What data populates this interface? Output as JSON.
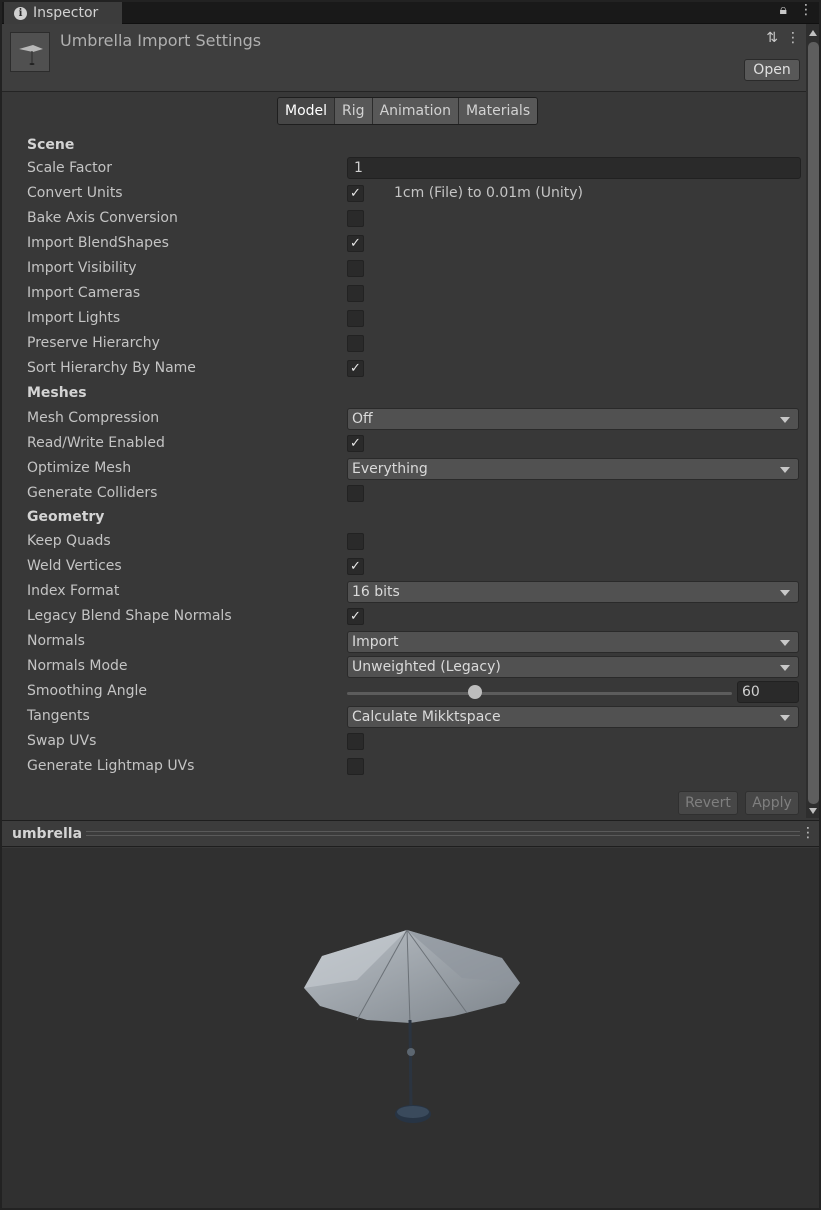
{
  "window": {
    "tab_label": "Inspector",
    "lock_icon": "lock-icon",
    "menu_icon": "kebab-menu-icon"
  },
  "header": {
    "title": "Umbrella Import Settings",
    "open_label": "Open"
  },
  "tabs": [
    "Model",
    "Rig",
    "Animation",
    "Materials"
  ],
  "scene": {
    "heading": "Scene",
    "scale_factor_label": "Scale Factor",
    "scale_factor_value": "1",
    "convert_units_label": "Convert Units",
    "convert_units_checked": true,
    "convert_units_text": "1cm (File) to 0.01m (Unity)",
    "bake_axis_label": "Bake Axis Conversion",
    "bake_axis_checked": false,
    "import_blendshapes_label": "Import BlendShapes",
    "import_blendshapes_checked": true,
    "import_visibility_label": "Import Visibility",
    "import_visibility_checked": false,
    "import_cameras_label": "Import Cameras",
    "import_cameras_checked": false,
    "import_lights_label": "Import Lights",
    "import_lights_checked": false,
    "preserve_hierarchy_label": "Preserve Hierarchy",
    "preserve_hierarchy_checked": false,
    "sort_hierarchy_label": "Sort Hierarchy By Name",
    "sort_hierarchy_checked": true
  },
  "meshes": {
    "heading": "Meshes",
    "mesh_compression_label": "Mesh Compression",
    "mesh_compression_value": "Off",
    "read_write_label": "Read/Write Enabled",
    "read_write_checked": true,
    "optimize_mesh_label": "Optimize Mesh",
    "optimize_mesh_value": "Everything",
    "generate_colliders_label": "Generate Colliders",
    "generate_colliders_checked": false
  },
  "geometry": {
    "heading": "Geometry",
    "keep_quads_label": "Keep Quads",
    "keep_quads_checked": false,
    "weld_vertices_label": "Weld Vertices",
    "weld_vertices_checked": true,
    "index_format_label": "Index Format",
    "index_format_value": "16 bits",
    "legacy_blend_label": "Legacy Blend Shape Normals",
    "legacy_blend_checked": true,
    "normals_label": "Normals",
    "normals_value": "Import",
    "normals_mode_label": "Normals Mode",
    "normals_mode_value": "Unweighted (Legacy)",
    "smoothing_angle_label": "Smoothing Angle",
    "smoothing_angle_value": "60",
    "smoothing_angle_fraction": 0.333,
    "tangents_label": "Tangents",
    "tangents_value": "Calculate Mikktspace",
    "swap_uvs_label": "Swap UVs",
    "swap_uvs_checked": false,
    "lightmap_uvs_label": "Generate Lightmap UVs",
    "lightmap_uvs_checked": false
  },
  "actions": {
    "revert_label": "Revert",
    "apply_label": "Apply"
  },
  "preview": {
    "title": "umbrella"
  }
}
